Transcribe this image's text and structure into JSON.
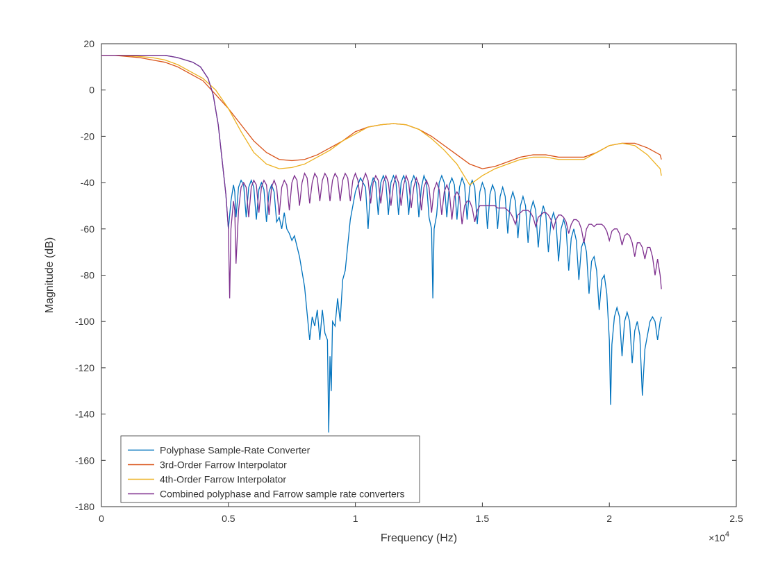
{
  "chart_data": {
    "type": "line",
    "xlabel": "Frequency (Hz)",
    "ylabel": "Magnitude (dB)",
    "x_exponent_label": "×10",
    "x_exponent_sup": "4",
    "xlim": [
      0,
      2.5
    ],
    "ylim": [
      -180,
      20
    ],
    "xticks": [
      0,
      0.5,
      1,
      1.5,
      2,
      2.5
    ],
    "yticks": [
      -180,
      -160,
      -140,
      -120,
      -100,
      -80,
      -60,
      -40,
      -20,
      0,
      20
    ],
    "legend_position": "bottom-left-inside",
    "series": [
      {
        "name": "Polyphase Sample-Rate Converter",
        "color": "#0072BD",
        "x": [
          0,
          0.05,
          0.1,
          0.15,
          0.2,
          0.25,
          0.3,
          0.33,
          0.36,
          0.39,
          0.42,
          0.44,
          0.46,
          0.475,
          0.49,
          0.5,
          0.51,
          0.52,
          0.525,
          0.53,
          0.54,
          0.55,
          0.56,
          0.57,
          0.58,
          0.59,
          0.6,
          0.61,
          0.62,
          0.63,
          0.64,
          0.65,
          0.66,
          0.67,
          0.68,
          0.69,
          0.7,
          0.71,
          0.72,
          0.73,
          0.74,
          0.75,
          0.76,
          0.78,
          0.8,
          0.82,
          0.83,
          0.84,
          0.85,
          0.86,
          0.87,
          0.88,
          0.89,
          0.895,
          0.9,
          0.905,
          0.91,
          0.92,
          0.93,
          0.94,
          0.95,
          0.96,
          0.97,
          0.98,
          0.99,
          1.0,
          1.02,
          1.04,
          1.05,
          1.06,
          1.07,
          1.08,
          1.09,
          1.1,
          1.11,
          1.12,
          1.13,
          1.14,
          1.15,
          1.16,
          1.17,
          1.18,
          1.19,
          1.2,
          1.21,
          1.22,
          1.23,
          1.24,
          1.25,
          1.26,
          1.27,
          1.28,
          1.29,
          1.3,
          1.305,
          1.31,
          1.32,
          1.33,
          1.34,
          1.35,
          1.36,
          1.37,
          1.38,
          1.39,
          1.4,
          1.41,
          1.42,
          1.43,
          1.44,
          1.45,
          1.46,
          1.47,
          1.48,
          1.49,
          1.5,
          1.51,
          1.52,
          1.53,
          1.54,
          1.55,
          1.56,
          1.57,
          1.58,
          1.59,
          1.6,
          1.61,
          1.62,
          1.63,
          1.64,
          1.65,
          1.66,
          1.67,
          1.68,
          1.69,
          1.7,
          1.71,
          1.72,
          1.73,
          1.74,
          1.75,
          1.76,
          1.77,
          1.78,
          1.79,
          1.8,
          1.81,
          1.82,
          1.83,
          1.84,
          1.85,
          1.86,
          1.87,
          1.88,
          1.89,
          1.9,
          1.91,
          1.92,
          1.93,
          1.94,
          1.95,
          1.96,
          1.97,
          1.98,
          1.99,
          2.0,
          2.005,
          2.01,
          2.02,
          2.03,
          2.04,
          2.05,
          2.06,
          2.07,
          2.08,
          2.09,
          2.1,
          2.11,
          2.12,
          2.13,
          2.14,
          2.15,
          2.16,
          2.17,
          2.18,
          2.19,
          2.2,
          2.205
        ],
        "y": [
          15,
          15,
          15,
          15,
          15,
          15,
          14,
          13,
          12,
          10,
          5,
          -2,
          -15,
          -30,
          -45,
          -60,
          -48,
          -41,
          -44,
          -55,
          -42,
          -39,
          -41,
          -55,
          -42,
          -39,
          -42,
          -56,
          -43,
          -40,
          -43,
          -57,
          -44,
          -41,
          -44,
          -57,
          -55,
          -60,
          -53,
          -60,
          -62,
          -65,
          -63,
          -72,
          -85,
          -108,
          -98,
          -102,
          -95,
          -108,
          -95,
          -105,
          -108,
          -148,
          -115,
          -130,
          -100,
          -102,
          -90,
          -100,
          -82,
          -78,
          -67,
          -56,
          -50,
          -44,
          -38,
          -42,
          -60,
          -42,
          -38,
          -40,
          -54,
          -40,
          -37,
          -40,
          -54,
          -40,
          -37,
          -40,
          -54,
          -40,
          -37,
          -40,
          -54,
          -40,
          -37,
          -40,
          -55,
          -42,
          -37,
          -40,
          -55,
          -60,
          -90,
          -60,
          -54,
          -40,
          -37,
          -40,
          -55,
          -41,
          -38,
          -41,
          -56,
          -42,
          -38,
          -41,
          -56,
          -42,
          -39,
          -42,
          -58,
          -44,
          -40,
          -43,
          -60,
          -45,
          -41,
          -44,
          -60,
          -46,
          -42,
          -46,
          -62,
          -48,
          -44,
          -48,
          -64,
          -50,
          -46,
          -50,
          -66,
          -52,
          -48,
          -52,
          -68,
          -55,
          -50,
          -54,
          -70,
          -57,
          -53,
          -57,
          -74,
          -60,
          -56,
          -60,
          -78,
          -64,
          -60,
          -65,
          -82,
          -68,
          -65,
          -70,
          -88,
          -74,
          -72,
          -78,
          -95,
          -82,
          -80,
          -88,
          -108,
          -136,
          -110,
          -98,
          -94,
          -98,
          -115,
          -100,
          -96,
          -100,
          -118,
          -104,
          -100,
          -106,
          -132,
          -112,
          -106,
          -100,
          -98,
          -100,
          -108,
          -100,
          -98,
          -99
        ]
      },
      {
        "name": "3rd-Order Farrow Interpolator",
        "color": "#D95319",
        "x": [
          0,
          0.05,
          0.1,
          0.15,
          0.2,
          0.25,
          0.3,
          0.35,
          0.4,
          0.45,
          0.5,
          0.55,
          0.6,
          0.65,
          0.7,
          0.75,
          0.8,
          0.85,
          0.9,
          0.95,
          1.0,
          1.05,
          1.1,
          1.15,
          1.2,
          1.25,
          1.3,
          1.35,
          1.4,
          1.45,
          1.5,
          1.55,
          1.6,
          1.65,
          1.7,
          1.75,
          1.8,
          1.85,
          1.9,
          1.95,
          2.0,
          2.05,
          2.1,
          2.15,
          2.2,
          2.205
        ],
        "y": [
          15,
          15,
          14.5,
          14,
          13,
          12,
          10,
          7,
          4,
          -2,
          -8,
          -15,
          -22,
          -27,
          -30,
          -30.5,
          -30,
          -28,
          -25,
          -22,
          -18,
          -16,
          -15,
          -14.5,
          -15,
          -17,
          -20,
          -24,
          -28,
          -32,
          -34,
          -33,
          -31,
          -29,
          -28,
          -28,
          -29,
          -29,
          -29,
          -27,
          -24,
          -23,
          -23,
          -25,
          -28,
          -30
        ]
      },
      {
        "name": "4th-Order Farrow Interpolator",
        "color": "#EDB120",
        "x": [
          0,
          0.05,
          0.1,
          0.15,
          0.2,
          0.25,
          0.3,
          0.35,
          0.4,
          0.45,
          0.5,
          0.55,
          0.6,
          0.65,
          0.7,
          0.75,
          0.8,
          0.85,
          0.9,
          0.95,
          1.0,
          1.05,
          1.1,
          1.15,
          1.2,
          1.25,
          1.3,
          1.35,
          1.4,
          1.45,
          1.5,
          1.55,
          1.6,
          1.65,
          1.7,
          1.75,
          1.8,
          1.85,
          1.9,
          1.95,
          2.0,
          2.05,
          2.1,
          2.15,
          2.2,
          2.205
        ],
        "y": [
          15,
          15,
          14.8,
          14.5,
          14,
          13,
          11,
          8,
          5,
          0,
          -8,
          -18,
          -27,
          -32,
          -34,
          -33.5,
          -32,
          -29,
          -26,
          -22,
          -19,
          -16,
          -15,
          -14.5,
          -15,
          -17,
          -21,
          -26,
          -32,
          -41,
          -37,
          -34,
          -32,
          -30,
          -29,
          -29,
          -30,
          -30,
          -30,
          -27,
          -24,
          -23,
          -24,
          -28,
          -34,
          -37
        ]
      },
      {
        "name": "Combined polyphase and Farrow sample rate converters",
        "color": "#7E2F8E",
        "x": [
          0,
          0.05,
          0.1,
          0.15,
          0.2,
          0.25,
          0.3,
          0.33,
          0.36,
          0.39,
          0.42,
          0.44,
          0.46,
          0.475,
          0.49,
          0.5,
          0.505,
          0.51,
          0.52,
          0.525,
          0.53,
          0.54,
          0.55,
          0.56,
          0.57,
          0.58,
          0.59,
          0.6,
          0.61,
          0.62,
          0.63,
          0.64,
          0.65,
          0.66,
          0.67,
          0.68,
          0.69,
          0.7,
          0.71,
          0.72,
          0.73,
          0.74,
          0.75,
          0.76,
          0.77,
          0.78,
          0.79,
          0.8,
          0.81,
          0.82,
          0.83,
          0.84,
          0.85,
          0.86,
          0.87,
          0.88,
          0.89,
          0.9,
          0.91,
          0.92,
          0.93,
          0.94,
          0.95,
          0.96,
          0.97,
          0.98,
          0.99,
          1.0,
          1.01,
          1.02,
          1.03,
          1.04,
          1.05,
          1.06,
          1.07,
          1.08,
          1.09,
          1.1,
          1.11,
          1.12,
          1.13,
          1.14,
          1.15,
          1.16,
          1.17,
          1.18,
          1.19,
          1.2,
          1.21,
          1.22,
          1.23,
          1.24,
          1.25,
          1.26,
          1.27,
          1.28,
          1.29,
          1.3,
          1.31,
          1.32,
          1.33,
          1.34,
          1.35,
          1.36,
          1.37,
          1.38,
          1.39,
          1.4,
          1.41,
          1.42,
          1.43,
          1.44,
          1.45,
          1.46,
          1.47,
          1.48,
          1.49,
          1.5,
          1.51,
          1.52,
          1.53,
          1.54,
          1.55,
          1.56,
          1.57,
          1.58,
          1.59,
          1.6,
          1.61,
          1.62,
          1.63,
          1.64,
          1.65,
          1.66,
          1.67,
          1.68,
          1.69,
          1.7,
          1.71,
          1.72,
          1.73,
          1.74,
          1.75,
          1.76,
          1.77,
          1.78,
          1.79,
          1.8,
          1.81,
          1.82,
          1.83,
          1.84,
          1.85,
          1.86,
          1.87,
          1.88,
          1.89,
          1.9,
          1.91,
          1.92,
          1.93,
          1.94,
          1.95,
          1.96,
          1.97,
          1.98,
          1.99,
          2.0,
          2.01,
          2.02,
          2.03,
          2.04,
          2.05,
          2.06,
          2.07,
          2.08,
          2.09,
          2.1,
          2.11,
          2.12,
          2.13,
          2.14,
          2.15,
          2.16,
          2.17,
          2.18,
          2.19,
          2.2,
          2.205
        ],
        "y": [
          15,
          15,
          15,
          15,
          15,
          15,
          14,
          13,
          12,
          10,
          5,
          -2,
          -15,
          -30,
          -45,
          -60,
          -90,
          -60,
          -48,
          -52,
          -75,
          -52,
          -42,
          -40,
          -42,
          -55,
          -42,
          -39,
          -41,
          -53,
          -42,
          -39,
          -41,
          -54,
          -42,
          -39,
          -42,
          -54,
          -42,
          -39,
          -41,
          -52,
          -40,
          -37,
          -39,
          -50,
          -40,
          -36,
          -38,
          -49,
          -40,
          -36,
          -38,
          -48,
          -39,
          -36,
          -38,
          -48,
          -39,
          -36,
          -38,
          -48,
          -39,
          -36,
          -38,
          -48,
          -39,
          -36,
          -39,
          -48,
          -39,
          -36,
          -39,
          -49,
          -40,
          -37,
          -39,
          -49,
          -40,
          -37,
          -40,
          -50,
          -41,
          -37,
          -40,
          -50,
          -41,
          -37,
          -40,
          -51,
          -42,
          -38,
          -41,
          -52,
          -42,
          -39,
          -42,
          -53,
          -43,
          -40,
          -43,
          -54,
          -44,
          -41,
          -44,
          -56,
          -46,
          -44,
          -46,
          -58,
          -50,
          -48,
          -48,
          -51,
          -57,
          -52,
          -50,
          -50,
          -50,
          -50,
          -50,
          -50,
          -50,
          -51,
          -51,
          -51,
          -51,
          -52,
          -53,
          -55,
          -58,
          -54,
          -53,
          -52,
          -52,
          -52,
          -53,
          -55,
          -59,
          -55,
          -54,
          -53,
          -53,
          -54,
          -56,
          -60,
          -56,
          -54,
          -54,
          -55,
          -57,
          -62,
          -58,
          -56,
          -56,
          -57,
          -60,
          -66,
          -60,
          -58,
          -58,
          -59,
          -58,
          -58,
          -58,
          -59,
          -61,
          -65,
          -61,
          -60,
          -60,
          -62,
          -67,
          -63,
          -62,
          -63,
          -66,
          -72,
          -66,
          -66,
          -68,
          -73,
          -68,
          -68,
          -72,
          -80,
          -73,
          -80,
          -86
        ]
      }
    ]
  }
}
